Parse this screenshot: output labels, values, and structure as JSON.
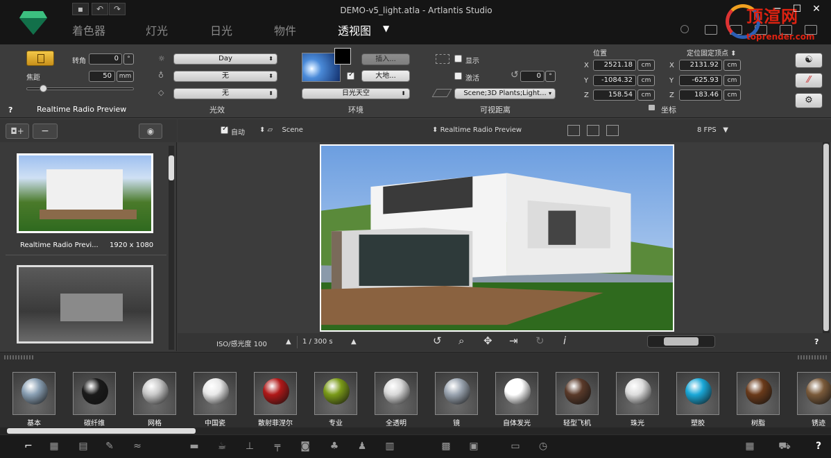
{
  "window": {
    "title": "DEMO-v5_light.atla - Artlantis Studio",
    "controls": [
      "─",
      "☐",
      "✕"
    ]
  },
  "watermark": {
    "text": "顶渲网",
    "url": "toprender.com"
  },
  "tabs": [
    {
      "label": "着色器"
    },
    {
      "label": "灯光"
    },
    {
      "label": "日光"
    },
    {
      "label": "物件"
    },
    {
      "label": "透视图"
    }
  ],
  "camera": {
    "rotation_label": "转角",
    "rotation_value": "0",
    "rotation_unit": "°",
    "focal_label": "焦距",
    "focal_value": "50",
    "focal_unit": "mm",
    "preview_name": "Realtime Radio Preview",
    "help": "?"
  },
  "lighting": {
    "section": "光效",
    "light_preset": "Day",
    "option2": "无",
    "option3": "无"
  },
  "environment": {
    "section": "环境",
    "insert_button": "插入...",
    "ground_button": "大地...",
    "sky": "日光天空"
  },
  "visibility": {
    "section": "可视距离",
    "show_label": "显示",
    "activate_label": "激活",
    "angle_value": "0",
    "angle_unit": "°",
    "scene_layers": "Scene;3D Plants;Light..."
  },
  "coords": {
    "section": "坐标",
    "position_label": "位置",
    "target_label": "定位固定顶点",
    "x": "2521.18",
    "y": "-1084.32",
    "z": "158.54",
    "tx": "2131.92",
    "ty": "-625.93",
    "tz": "183.46",
    "unit": "cm",
    "axis_x": "X",
    "axis_y": "Y",
    "axis_z": "Z"
  },
  "viewlist": {
    "items": [
      {
        "name": "Realtime Radio Previ...",
        "resolution": "1920 x 1080"
      },
      {
        "name": "",
        "resolution": ""
      }
    ],
    "remove": "−"
  },
  "viewtoolbar": {
    "auto_label": "自动",
    "scene": "Scene",
    "preset": "Realtime Radio Preview",
    "fps": "8 FPS"
  },
  "viewbottom": {
    "iso": "ISO/感光度 100",
    "shutter": "1 / 300 s",
    "help": "?"
  },
  "materials": [
    {
      "label": "基本",
      "color": "#8aa0b4"
    },
    {
      "label": "碳纤维",
      "color": "#1a1a1a"
    },
    {
      "label": "网格",
      "color": "#c8c8c8"
    },
    {
      "label": "中国瓷",
      "color": "#e8e8e8"
    },
    {
      "label": "散射菲涅尔",
      "color": "#b01818"
    },
    {
      "label": "专业",
      "color": "#7a9a18"
    },
    {
      "label": "全透明",
      "color": "#d8d8d8"
    },
    {
      "label": "镜",
      "color": "#9aa4b0"
    },
    {
      "label": "自体发光",
      "color": "#ffffff"
    },
    {
      "label": "轻型飞机",
      "color": "#5a3a2a"
    },
    {
      "label": "珠光",
      "color": "#dcdcdc"
    },
    {
      "label": "塑胶",
      "color": "#1aa8d8"
    },
    {
      "label": "树脂",
      "color": "#6a3a1a"
    },
    {
      "label": "锈迹",
      "color": "#7a5a3a"
    }
  ],
  "bottombar": {
    "help": "?"
  }
}
